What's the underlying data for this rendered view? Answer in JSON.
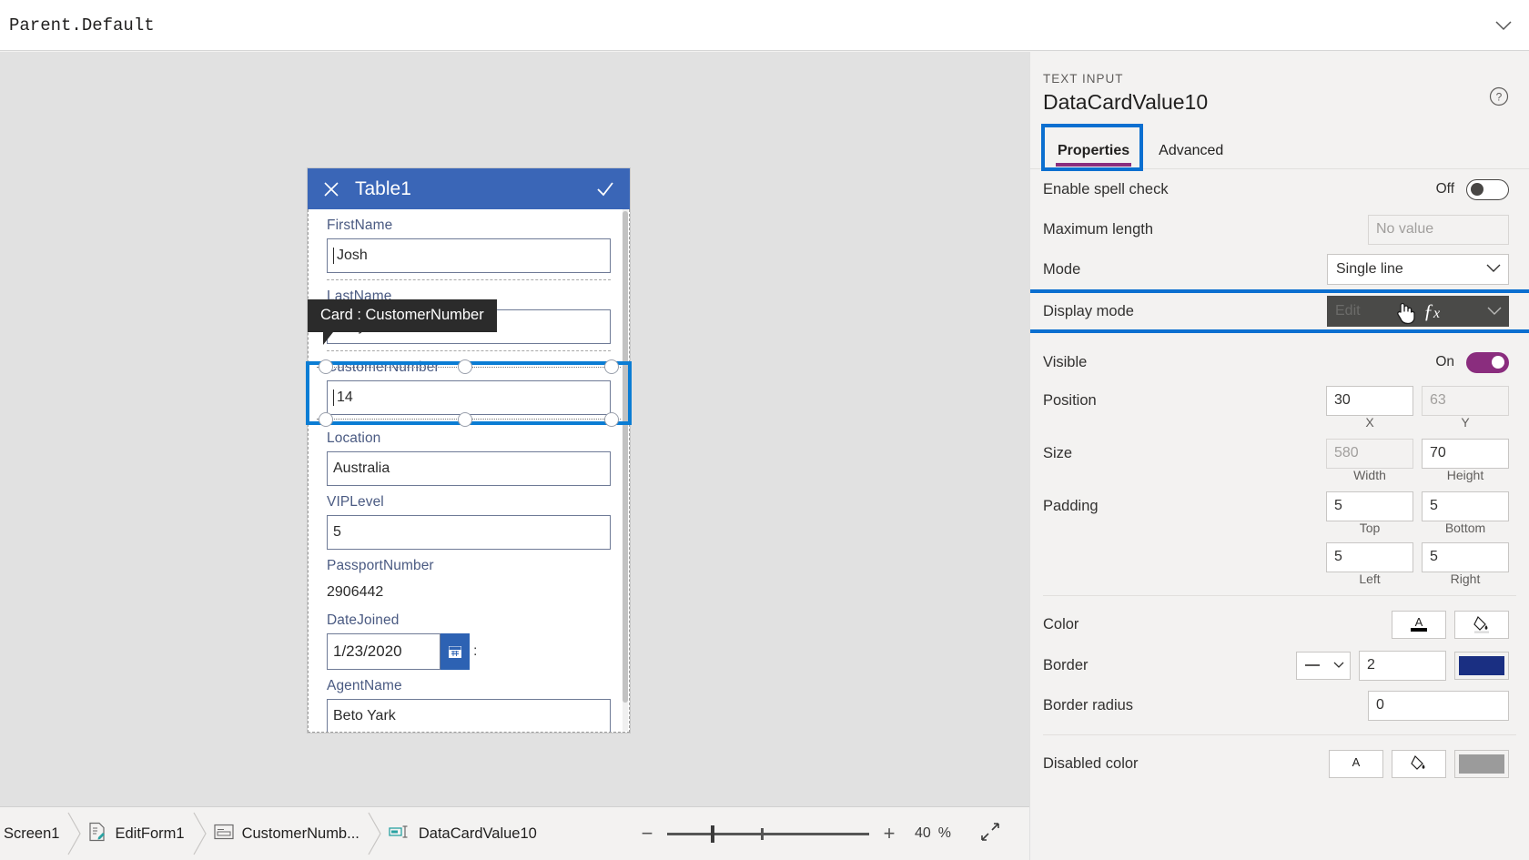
{
  "formula_bar": {
    "value": "Parent.Default",
    "expand_icon": "chevron-down-icon"
  },
  "form": {
    "title": "Table1",
    "close_icon": "close-icon",
    "confirm_icon": "checkmark-icon",
    "tooltip": "Card : CustomerNumber",
    "fields": [
      {
        "label": "FirstName",
        "value": "Josh",
        "type": "input"
      },
      {
        "label": "LastName",
        "value": "Mery",
        "type": "input"
      },
      {
        "label": "CustomerNumber",
        "value": "14",
        "type": "input"
      },
      {
        "label": "Location",
        "value": "Australia",
        "type": "input"
      },
      {
        "label": "VIPLevel",
        "value": "5",
        "type": "input"
      },
      {
        "label": "PassportNumber",
        "value": "2906442",
        "type": "static"
      },
      {
        "label": "DateJoined",
        "value": "1/23/2020",
        "type": "date"
      },
      {
        "label": "AgentName",
        "value": "Beto Yark",
        "type": "input"
      }
    ],
    "date_icon": "calendar-icon",
    "date_suffix": ":"
  },
  "panel": {
    "kicker": "TEXT INPUT",
    "title": "DataCardValue10",
    "help_icon": "help-circle-icon",
    "tabs": [
      {
        "label": "Properties",
        "active": true
      },
      {
        "label": "Advanced",
        "active": false
      }
    ],
    "properties": {
      "spell_check": {
        "label": "Enable spell check",
        "state": "Off"
      },
      "maximum_length": {
        "label": "Maximum length",
        "placeholder": "No value"
      },
      "mode": {
        "label": "Mode",
        "value": "Single line",
        "chevron": "chevron-down-icon"
      },
      "display_mode": {
        "label": "Display mode",
        "value": "Edit",
        "fx_icon": "fx-icon",
        "cursor_icon": "hand-pointer-icon",
        "chevron": "chevron-down-icon"
      },
      "visible": {
        "label": "Visible",
        "state": "On"
      },
      "position": {
        "label": "Position",
        "x": "30",
        "y": "63",
        "x_label": "X",
        "y_label": "Y"
      },
      "size": {
        "label": "Size",
        "width": "580",
        "height": "70",
        "width_label": "Width",
        "height_label": "Height"
      },
      "padding": {
        "label": "Padding",
        "top": "5",
        "bottom": "5",
        "left": "5",
        "right": "5",
        "top_label": "Top",
        "bottom_label": "Bottom",
        "left_label": "Left",
        "right_label": "Right"
      },
      "color": {
        "label": "Color",
        "font_icon": "font-color-icon",
        "fill_icon": "fill-color-icon"
      },
      "border": {
        "label": "Border",
        "style_icon": "line-style-icon",
        "width": "2",
        "color": "#1a2f82"
      },
      "border_radius": {
        "label": "Border radius",
        "value": "0"
      },
      "disabled_color": {
        "label": "Disabled color",
        "font_icon": "font-color-icon",
        "fill_icon": "fill-color-icon",
        "color": "#9b9b9b"
      }
    }
  },
  "bottom": {
    "breadcrumb": [
      {
        "label": "Screen1",
        "icon": ""
      },
      {
        "label": "EditForm1",
        "icon": "form-icon"
      },
      {
        "label": "CustomerNumb...",
        "icon": "card-icon"
      },
      {
        "label": "DataCardValue10",
        "icon": "textinput-icon"
      }
    ],
    "zoom": {
      "minus": "−",
      "plus": "+",
      "value": "40",
      "percent": "%"
    },
    "fullscreen_icon": "expand-diagonal-icon"
  },
  "colors": {
    "accent_blue": "#0b6fd0",
    "form_header": "#3a66b7",
    "tab_underline": "#8a2d7e",
    "toggle_on": "#8a2d7e",
    "border_navy": "#1a2f82"
  }
}
